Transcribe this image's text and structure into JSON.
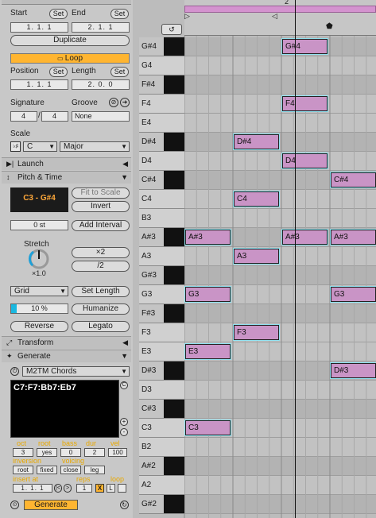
{
  "clip": {
    "start_label": "Start",
    "end_label": "End",
    "set": "Set",
    "start_val": "1.   1.   1",
    "end_val": "2.   1.   1",
    "duplicate": "Duplicate",
    "loop": "Loop",
    "position_label": "Position",
    "length_label": "Length",
    "position_val": "1.   1.   1",
    "length_val": "2.   0.   0",
    "signature_label": "Signature",
    "groove_label": "Groove",
    "sig_num": "4",
    "sig_den": "4",
    "groove_val": "None",
    "scale_label": "Scale",
    "scale_root": "C",
    "scale_mode": "Major"
  },
  "launch": {
    "title": "Launch"
  },
  "pitch": {
    "title": "Pitch & Time",
    "range": "C3 - G#4",
    "fit_to_scale": "Fit to Scale",
    "invert": "Invert",
    "transpose": "0 st",
    "add_interval": "Add Interval",
    "stretch_label": "Stretch",
    "stretch_val": "×1.0",
    "times2": "×2",
    "div2": "/2",
    "grid": "Grid",
    "set_length": "Set Length",
    "percent": "10 %",
    "humanize": "Humanize",
    "reverse": "Reverse",
    "legato": "Legato"
  },
  "transform": {
    "title": "Transform"
  },
  "generate": {
    "title": "Generate",
    "device": "M2TM Chords",
    "chords": "C7:F7:Bb7:Eb7",
    "c_btn": "C",
    "oct_label": "oct",
    "root_label": "root",
    "bass_label": "bass",
    "dur_label": "dur",
    "vel_label": "vel",
    "oct": "3",
    "root": "yes",
    "bass": "0",
    "dur": "2",
    "vel": "100",
    "inversion_label": "inversion",
    "voicing_label": "voicing",
    "inv_root": "root",
    "inv_fixed": "fixed",
    "voi_close": "close",
    "voi_leg": "leg",
    "insert_label": "insert at",
    "reps_label": "reps",
    "loop_label": "loop",
    "insert_val": "1.   1.   1",
    "reps_val": "1",
    "x_btn": "X",
    "l_btn": "L",
    "button": "Generate"
  },
  "ruler": {
    "marker": "2"
  },
  "keys": [
    {
      "name": "G#4",
      "black": true
    },
    {
      "name": "G4",
      "black": false
    },
    {
      "name": "F#4",
      "black": true
    },
    {
      "name": "F4",
      "black": false
    },
    {
      "name": "E4",
      "black": false
    },
    {
      "name": "D#4",
      "black": true
    },
    {
      "name": "D4",
      "black": false
    },
    {
      "name": "C#4",
      "black": true
    },
    {
      "name": "C4",
      "black": false
    },
    {
      "name": "B3",
      "black": false
    },
    {
      "name": "A#3",
      "black": true
    },
    {
      "name": "A3",
      "black": false
    },
    {
      "name": "G#3",
      "black": true
    },
    {
      "name": "G3",
      "black": false
    },
    {
      "name": "F#3",
      "black": true
    },
    {
      "name": "F3",
      "black": false
    },
    {
      "name": "E3",
      "black": false
    },
    {
      "name": "D#3",
      "black": true
    },
    {
      "name": "D3",
      "black": false
    },
    {
      "name": "C#3",
      "black": true
    },
    {
      "name": "C3",
      "black": false
    },
    {
      "name": "B2",
      "black": false
    },
    {
      "name": "A#2",
      "black": true
    },
    {
      "name": "A2",
      "black": false
    },
    {
      "name": "G#2",
      "black": true
    }
  ],
  "notes": [
    {
      "pitch": "G#4",
      "label": "G#4",
      "slot": 2
    },
    {
      "pitch": "F4",
      "label": "F4",
      "slot": 2
    },
    {
      "pitch": "D#4",
      "label": "D#4",
      "slot": 1
    },
    {
      "pitch": "D4",
      "label": "D4",
      "slot": 2
    },
    {
      "pitch": "C#4",
      "label": "C#4",
      "slot": 3
    },
    {
      "pitch": "C4",
      "label": "C4",
      "slot": 1
    },
    {
      "pitch": "A#3",
      "label": "A#3",
      "slot": 0
    },
    {
      "pitch": "A#3",
      "label": "A#3",
      "slot": 2
    },
    {
      "pitch": "A#3",
      "label": "A#3",
      "slot": 3
    },
    {
      "pitch": "A3",
      "label": "A3",
      "slot": 1
    },
    {
      "pitch": "G3",
      "label": "G3",
      "slot": 0
    },
    {
      "pitch": "G3",
      "label": "G3",
      "slot": 3
    },
    {
      "pitch": "F3",
      "label": "F3",
      "slot": 1
    },
    {
      "pitch": "E3",
      "label": "E3",
      "slot": 0
    },
    {
      "pitch": "D#3",
      "label": "D#3",
      "slot": 3
    },
    {
      "pitch": "C3",
      "label": "C3",
      "slot": 0
    }
  ],
  "colors": {
    "loop": "#ffb531",
    "note": "#c994c6",
    "accent": "#e8a800"
  }
}
